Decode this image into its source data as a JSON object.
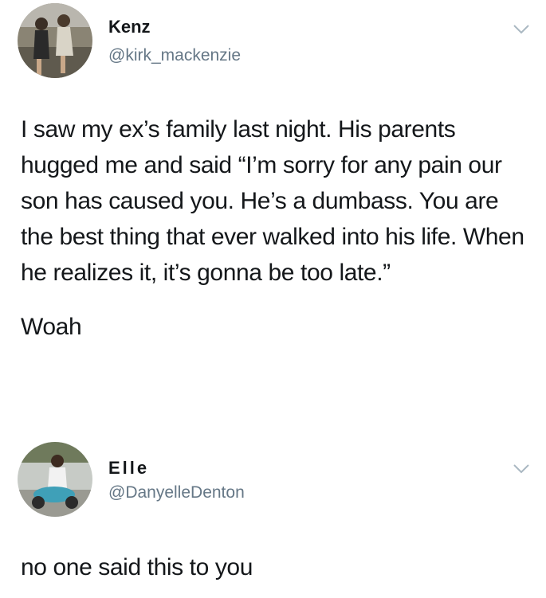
{
  "tweets": [
    {
      "display_name": "Kenz",
      "handle": "@kirk_mackenzie",
      "avatar_icon": "profile-photo",
      "menu_icon": "chevron-down-icon",
      "paragraphs": [
        "I saw my ex’s family last night. His parents hugged me and said “I’m sorry for any pain our son has caused you. He’s a dumbass. You are the best thing that ever walked into his life. When he realizes it, it’s gonna be too late.”",
        "Woah"
      ]
    },
    {
      "display_name": "Elle",
      "handle": "@DanyelleDenton",
      "avatar_icon": "profile-photo",
      "menu_icon": "chevron-down-icon",
      "text": "no one said this to you"
    }
  ],
  "colors": {
    "text": "#14171a",
    "handle": "#657786",
    "chevron": "#aab8c2",
    "background": "#ffffff"
  }
}
